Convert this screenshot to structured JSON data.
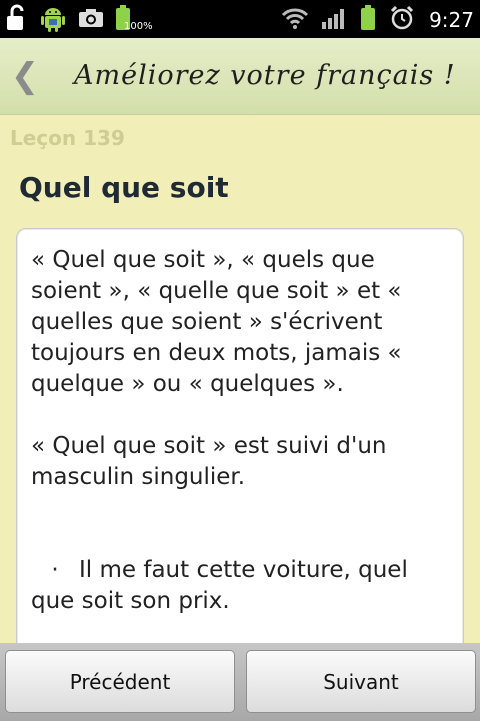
{
  "status_bar": {
    "battery_percent": "100%",
    "time": "9:27"
  },
  "header": {
    "back_glyph": "❮",
    "title": "Améliorez votre français !"
  },
  "lesson": {
    "number": "Leçon 139",
    "title": "Quel que soit"
  },
  "content": {
    "paragraph1": "« Quel que soit », « quels que soient », « quelle que soit » et « quelles que soient » s'écrivent toujours en deux mots, jamais « quelque » ou « quelques ».",
    "paragraph2": "« Quel que soit » est suivi d'un masculin singulier.",
    "example_bullet": "·",
    "example": "Il me faut cette voiture, quel que soit son prix."
  },
  "buttons": {
    "previous": "Précédent",
    "next": "Suivant"
  },
  "icons": {
    "status_left": [
      "unlock-icon",
      "android-icon",
      "camera-icon",
      "battery-icon"
    ],
    "status_right": [
      "wifi-icon",
      "signal-icon",
      "battery-icon",
      "alarm-icon"
    ]
  }
}
